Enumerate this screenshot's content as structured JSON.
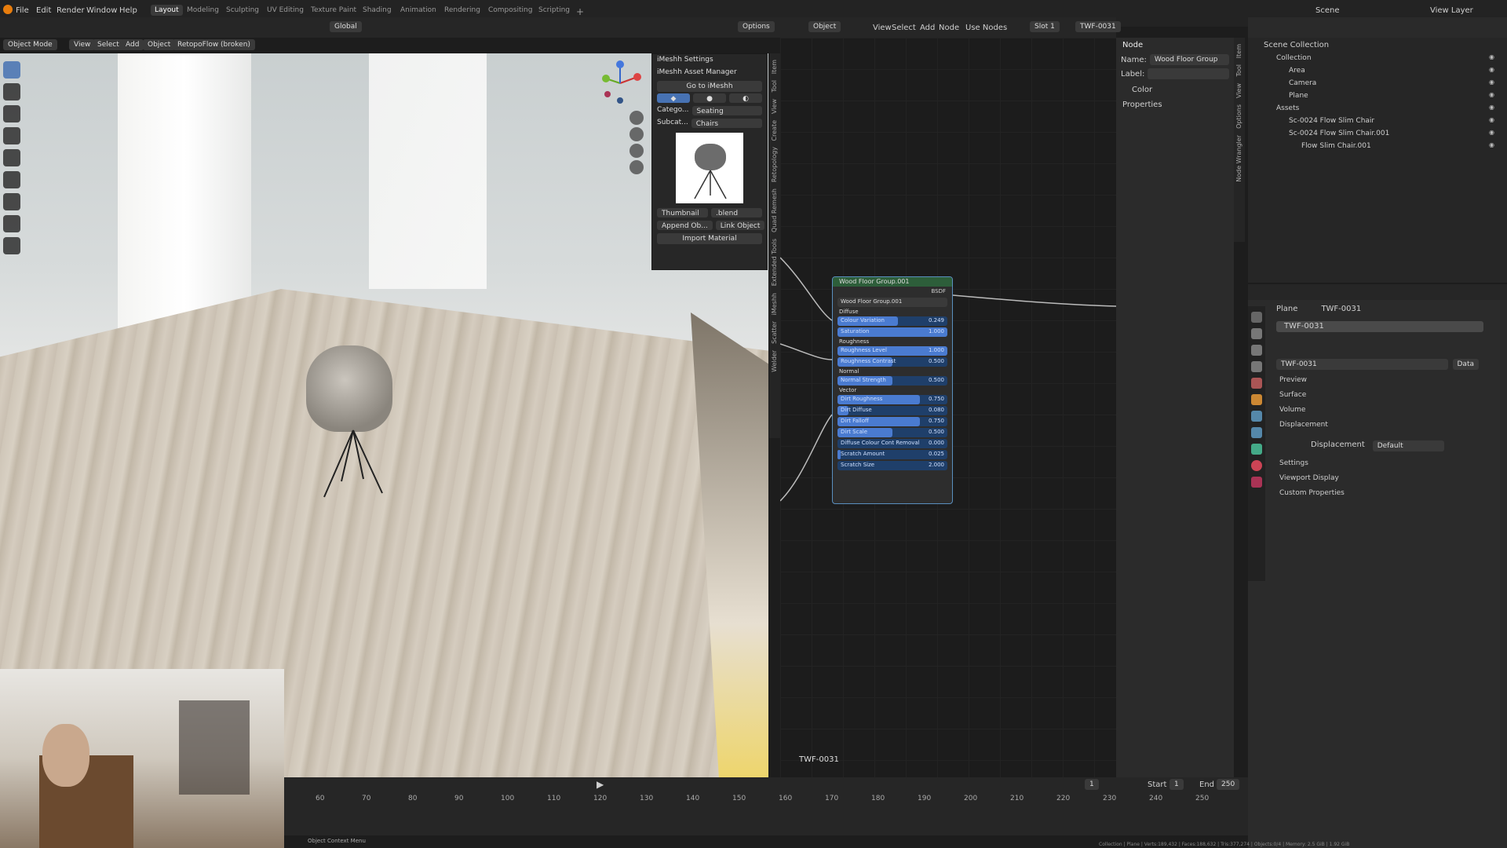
{
  "menu": [
    "File",
    "Edit",
    "Render",
    "Window",
    "Help"
  ],
  "workspaces": [
    "Layout",
    "Modeling",
    "Sculpting",
    "UV Editing",
    "Texture Paint",
    "Shading",
    "Animation",
    "Rendering",
    "Compositing",
    "Scripting"
  ],
  "scene": "Scene",
  "view_layer": "View Layer",
  "viewport": {
    "mode": "Object Mode",
    "menus": [
      "View",
      "Select",
      "Add",
      "Object"
    ],
    "addon": "RetopoFlow (broken)",
    "transform": "Global",
    "options": "Options"
  },
  "imeshh": {
    "settings": "iMeshh Settings",
    "asset_manager": "iMeshh Asset Manager",
    "go_to": "Go to iMeshh",
    "category_label": "Catego...",
    "category": "Seating",
    "subcat_label": "Subcat...",
    "subcat": "Chairs",
    "thumbnail": "Thumbnail",
    "blend": ".blend",
    "append": "Append Ob...",
    "link": "Link Object",
    "import_material": "Import Material"
  },
  "ntabs": [
    "Item",
    "Tool",
    "View",
    "Create",
    "Retopology",
    "Quad Remesh",
    "Extended Tools",
    "iMeshh",
    "Scatter",
    "Welder"
  ],
  "node_editor": {
    "menus": [
      "Object",
      "View",
      "Select",
      "Add",
      "Node"
    ],
    "use_nodes": "Use Nodes",
    "slot": "Slot 1",
    "material": "TWF-0031",
    "footer": "TWF-0031"
  },
  "node": {
    "title": "Wood Floor Group.001",
    "bsdf": "BSDF",
    "group": "Wood Floor Group.001",
    "sections": [
      {
        "name": "Diffuse",
        "fields": [
          {
            "label": "Colour Variation",
            "value": "0.249",
            "fill": 0.55
          },
          {
            "label": "Saturation",
            "value": "1.000",
            "fill": 1.0
          }
        ]
      },
      {
        "name": "Roughness",
        "fields": [
          {
            "label": "Roughness Level",
            "value": "1.000",
            "fill": 1.0
          },
          {
            "label": "Roughness Contrast",
            "value": "0.500",
            "fill": 0.5
          }
        ]
      },
      {
        "name": "Normal",
        "fields": [
          {
            "label": "Normal Strength",
            "value": "0.500",
            "fill": 0.5
          }
        ]
      },
      {
        "name": "Vector",
        "fields": [
          {
            "label": "Dirt Roughness",
            "value": "0.750",
            "fill": 0.75
          },
          {
            "label": "Dirt Diffuse",
            "value": "0.080",
            "fill": 0.1
          },
          {
            "label": "Dirt Falloff",
            "value": "0.750",
            "fill": 0.75
          },
          {
            "label": "Dirt Scale",
            "value": "0.500",
            "fill": 0.5
          },
          {
            "label": "Diffuse Colour Cont Removal",
            "value": "0.000",
            "fill": 0
          },
          {
            "label": "Scratch Amount",
            "value": "0.025",
            "fill": 0.03
          },
          {
            "label": "Scratch Size",
            "value": "2.000",
            "fill": 0
          }
        ]
      }
    ]
  },
  "node_sidebar": {
    "header": "Node",
    "name_label": "Name:",
    "name": "Wood Floor Group",
    "label_label": "Label:",
    "color": "Color",
    "properties": "Properties",
    "tabs": [
      "Item",
      "Tool",
      "View",
      "Options",
      "Node Wrangler"
    ]
  },
  "outliner": {
    "root": "Scene Collection",
    "items": [
      {
        "name": "Collection",
        "indent": 1
      },
      {
        "name": "Area",
        "indent": 2
      },
      {
        "name": "Camera",
        "indent": 2
      },
      {
        "name": "Plane",
        "indent": 2
      },
      {
        "name": "Assets",
        "indent": 1
      },
      {
        "name": "Sc-0024 Flow Slim Chair",
        "indent": 2
      },
      {
        "name": "Sc-0024 Flow Slim Chair.001",
        "indent": 2
      },
      {
        "name": "Flow Slim Chair.001",
        "indent": 3
      }
    ]
  },
  "properties": {
    "object": "Plane",
    "material": "TWF-0031",
    "slot_material": "TWF-0031",
    "data": "Data",
    "panels": [
      "Preview",
      "Surface",
      "Volume",
      "Displacement"
    ],
    "displacement_label": "Displacement",
    "displacement_value": "Default",
    "panels2": [
      "Settings",
      "Viewport Display",
      "Custom Properties"
    ]
  },
  "timeline": {
    "ticks": [
      "60",
      "70",
      "80",
      "90",
      "100",
      "110",
      "120",
      "130",
      "140",
      "150",
      "160",
      "170",
      "180",
      "190",
      "200",
      "210",
      "220",
      "230",
      "240",
      "250"
    ],
    "current": "1",
    "start_label": "Start",
    "start": "1",
    "end_label": "End",
    "end": "250"
  },
  "status": {
    "left": "Object Context Menu",
    "right": "Collection | Plane | Verts:189,432 | Faces:188,632 | Tris:377,274 | Objects:0/4 | Memory: 2.5 GiB | 1.92 GiB"
  },
  "colors": {
    "accent": "#4772b3",
    "node_border": "#5a8fbf",
    "field_fill": "#4a7bd0"
  }
}
